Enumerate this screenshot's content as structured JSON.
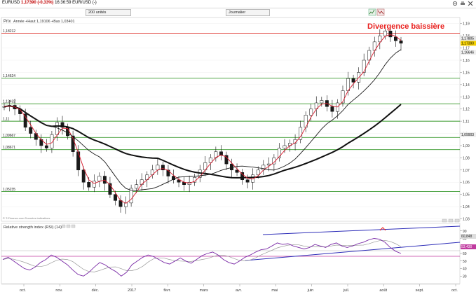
{
  "window": {
    "symbol": "EURUSD",
    "price": "1,17390",
    "change": "(-0,33%)",
    "time": "16:36:59",
    "pair": "EUR/USD",
    "suffix": "(-)"
  },
  "toolbar": {
    "units_select": "200 unités",
    "period_select": "Journalier"
  },
  "price_panel": {
    "label": "Prix",
    "info": "Année +Haut 1,19106 +Bas 1,03401",
    "annotation": "Divergence baissière",
    "credit": "© T-Finance.com Données indicatives"
  },
  "rsi_panel": {
    "label": "Relative strength index (RSI) (14)",
    "value_upper": "60,848",
    "value_lower": "53,430"
  },
  "colors": {
    "annotation": "#e8201e",
    "level_line": "#3a9a2f",
    "ma_red": "#d81a2c",
    "ma_black": "#111111",
    "rsi": "#7a2aa6",
    "trend": "#2d2db8"
  },
  "chart_data": {
    "type": "line",
    "title": "EURUSD",
    "ylabel": "",
    "y_ticks": [
      "1,19",
      "1,18",
      "1,17",
      "1,16",
      "1,15",
      "1,14",
      "1,13",
      "1,12",
      "1,11",
      "1,1",
      "1,09",
      "1,08",
      "1,07",
      "1,06",
      "1,05",
      "1,04",
      "1,03"
    ],
    "ylim": [
      1.028,
      1.195
    ],
    "x_labels": [
      "oct.",
      "nov.",
      "déc.",
      "2017",
      "févr.",
      "mars",
      "avr.",
      "mai",
      "juin",
      "juil.",
      "août",
      "sept.",
      "oct."
    ],
    "support_resistance_levels": [
      "1,18212",
      "1,14524",
      "1,12432",
      "1,11",
      "1,09667",
      "1,08671",
      "1,05235"
    ],
    "current_price_labels": [
      "1,17805",
      "1,17390",
      "1,16646",
      "1,09903"
    ],
    "close_series": [
      1.122,
      1.123,
      1.12,
      1.116,
      1.105,
      1.1,
      1.095,
      1.09,
      1.088,
      1.099,
      1.109,
      1.105,
      1.098,
      1.085,
      1.07,
      1.06,
      1.056,
      1.061,
      1.065,
      1.059,
      1.05,
      1.045,
      1.04,
      1.043,
      1.055,
      1.058,
      1.062,
      1.066,
      1.07,
      1.074,
      1.07,
      1.065,
      1.062,
      1.06,
      1.058,
      1.06,
      1.064,
      1.07,
      1.076,
      1.08,
      1.085,
      1.082,
      1.075,
      1.07,
      1.068,
      1.062,
      1.06,
      1.066,
      1.07,
      1.074,
      1.075,
      1.08,
      1.088,
      1.09,
      1.092,
      1.095,
      1.105,
      1.115,
      1.12,
      1.125,
      1.127,
      1.122,
      1.118,
      1.125,
      1.135,
      1.145,
      1.142,
      1.15,
      1.16,
      1.168,
      1.175,
      1.18,
      1.184,
      1.179,
      1.176,
      1.1739
    ],
    "rsi_series": [
      52,
      55,
      50,
      45,
      40,
      38,
      42,
      48,
      52,
      58,
      55,
      50,
      45,
      38,
      32,
      30,
      35,
      42,
      48,
      45,
      40,
      36,
      30,
      35,
      45,
      50,
      55,
      58,
      56,
      52,
      48,
      46,
      50,
      54,
      50,
      47,
      52,
      57,
      60,
      62,
      58,
      52,
      48,
      46,
      50,
      55,
      58,
      62,
      65,
      66,
      70,
      74,
      72,
      73,
      70,
      68,
      66,
      68,
      72,
      70,
      68,
      72,
      74,
      70,
      68,
      70,
      73,
      75,
      78,
      80,
      79,
      75,
      68,
      63,
      60
    ]
  }
}
